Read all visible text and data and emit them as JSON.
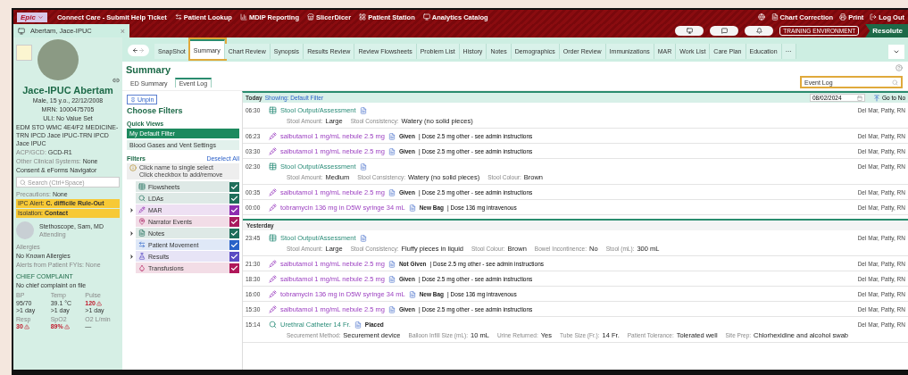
{
  "topbar": {
    "app_menu": "Epic",
    "links": [
      "Connect Care - Submit Help Ticket",
      "Patient Lookup",
      "MDIP Reporting",
      "SlicerDicer",
      "Patient Station",
      "Analytics Catalog"
    ],
    "actions": [
      "Chart Correction",
      "Print",
      "Log Out"
    ]
  },
  "patient_tab": {
    "name": "Abertam, Jace-IPUC",
    "close": "×"
  },
  "environment": {
    "badge": "TRAINING ENVIRONMENT",
    "status": "Resolute"
  },
  "sidebar": {
    "name": "Jace-IPUC Abertam",
    "demographics": [
      "Male, 15 y.o., 22/12/2008",
      "MRN: 1000475705",
      "ULI: No Value Set"
    ],
    "location": "EDM STO WMC 4E4/F2 MEDICINE-TRN IPCD Jace IPUC-TRN IPCD Jace IPUC",
    "info": [
      {
        "label": "ACP/GCD:",
        "value": "GCD-R1"
      },
      {
        "label": "Other Clinical Systems:",
        "value": "None"
      }
    ],
    "consent": "Consent & eForms Navigator",
    "search_placeholder": "Search (Ctrl+Space)",
    "precautions": {
      "label": "Precautions:",
      "value": "None"
    },
    "alerts": [
      {
        "label": "IPC Alert:",
        "value": "C. difficile Rule-Out"
      },
      {
        "label": "Isolation:",
        "value": "Contact"
      }
    ],
    "provider": {
      "name": "Stethoscope, Sam, MD",
      "role": "Attending"
    },
    "allergies": {
      "title": "Allergies",
      "value": "No Known Allergies",
      "fyi": "Alerts from Patient FYIs: None"
    },
    "chief_complaint": {
      "title": "CHIEF COMPLAINT",
      "value": "No chief complaint on file"
    },
    "vitals": [
      {
        "label": "BP",
        "value": "95/70",
        "time": ">1 day",
        "abnormal": false
      },
      {
        "label": "Temp",
        "value": "39.1 °C",
        "time": ">1 day",
        "abnormal": false
      },
      {
        "label": "Pulse",
        "value": "120",
        "time": ">1 day",
        "abnormal": true
      },
      {
        "label": "Resp",
        "value": "30",
        "abnormal": true
      },
      {
        "label": "SpO2",
        "value": "89%",
        "abnormal": true
      },
      {
        "label": "O2 L/min",
        "value": "—",
        "abnormal": false
      }
    ]
  },
  "tabs": [
    {
      "label": "SnapShot",
      "selected": false
    },
    {
      "label": "Summary",
      "selected": true
    },
    {
      "label": "Chart Review",
      "selected": false
    },
    {
      "label": "Synopsis",
      "selected": false
    },
    {
      "label": "Results Review",
      "selected": false
    },
    {
      "label": "Review Flowsheets",
      "selected": false
    },
    {
      "label": "Problem List",
      "selected": false
    },
    {
      "label": "History",
      "selected": false
    },
    {
      "label": "Notes",
      "selected": false
    },
    {
      "label": "Demographics",
      "selected": false
    },
    {
      "label": "Order Review",
      "selected": false
    },
    {
      "label": "Immunizations",
      "selected": false
    },
    {
      "label": "MAR",
      "selected": false
    },
    {
      "label": "Work List",
      "selected": false
    },
    {
      "label": "Care Plan",
      "selected": false
    },
    {
      "label": "Education",
      "selected": false
    },
    {
      "label": "···",
      "selected": false
    }
  ],
  "summary": {
    "title": "Summary",
    "subtabs": [
      {
        "label": "ED Summary",
        "selected": false
      },
      {
        "label": "Event Log",
        "selected": true
      }
    ],
    "search_value": "Event Log"
  },
  "filters": {
    "unpin": "Unpin",
    "title": "Choose Filters",
    "quick_views_title": "Quick Views",
    "quick_views": [
      {
        "label": "My Default Filter",
        "selected": true
      },
      {
        "label": "Blood Gases and Vent Settings",
        "selected": false
      }
    ],
    "filters_title": "Filters",
    "deselect_all": "Deselect All",
    "hint": [
      "Click name to single select",
      "Click checkbox to add/remove"
    ],
    "items": [
      {
        "label": "Flowsheets",
        "checked": true,
        "expandable": false,
        "color": "#1f6e5a"
      },
      {
        "label": "LDAs",
        "checked": true,
        "expandable": false,
        "color": "#1f6e5a"
      },
      {
        "label": "MAR",
        "checked": true,
        "expandable": true,
        "color": "#8e2cb0"
      },
      {
        "label": "Narrator Events",
        "checked": true,
        "expandable": false,
        "color": "#a8195e"
      },
      {
        "label": "Notes",
        "checked": true,
        "expandable": true,
        "color": "#1f6e5a"
      },
      {
        "label": "Patient Movement",
        "checked": true,
        "expandable": false,
        "color": "#2a62c8"
      },
      {
        "label": "Results",
        "checked": true,
        "expandable": true,
        "color": "#5b4cc4"
      },
      {
        "label": "Transfusions",
        "checked": true,
        "expandable": false,
        "color": "#b0185a"
      }
    ]
  },
  "event_log": {
    "showing": "Showing: Default Filter",
    "date": "08/02/2024",
    "go_to_now": "Go to No",
    "groups": [
      {
        "label": "Today",
        "events": [
          {
            "time": "06:30",
            "kind": "flowsheet",
            "title": "Stool Output/Assessment",
            "user": "Del Mar, Patty, RN",
            "fields": [
              {
                "label": "Stool Amount:",
                "value": "Large"
              },
              {
                "label": "Stool Consistency:",
                "value": "Watery (no solid pieces)"
              }
            ]
          },
          {
            "time": "06:23",
            "kind": "mar",
            "title": "salbutamol 1 mg/mL nebule 2.5 mg",
            "status": "Given",
            "detail": "| Dose 2.5 mg other - see admin instructions",
            "user": "Del Mar, Patty, RN"
          },
          {
            "time": "03:30",
            "kind": "mar",
            "title": "salbutamol 1 mg/mL nebule 2.5 mg",
            "status": "Given",
            "detail": "| Dose 2.5 mg other - see admin instructions",
            "user": "Del Mar, Patty, RN"
          },
          {
            "time": "02:30",
            "kind": "flowsheet",
            "title": "Stool Output/Assessment",
            "user": "Del Mar, Patty, RN",
            "fields": [
              {
                "label": "Stool Amount:",
                "value": "Medium"
              },
              {
                "label": "Stool Consistency:",
                "value": "Watery (no solid pieces)"
              },
              {
                "label": "Stool Colour:",
                "value": "Brown"
              }
            ]
          },
          {
            "time": "00:35",
            "kind": "mar",
            "title": "salbutamol 1 mg/mL nebule 2.5 mg",
            "status": "Given",
            "detail": "| Dose 2.5 mg other - see admin instructions",
            "user": "Del Mar, Patty, RN"
          },
          {
            "time": "00:00",
            "kind": "mar",
            "title": "tobramycin 136 mg in D5W syringe 34 mL",
            "status": "New Bag",
            "detail": "| Dose 136 mg intravenous",
            "user": "Del Mar, Patty, RN"
          }
        ]
      },
      {
        "label": "Yesterday",
        "events": [
          {
            "time": "23:45",
            "kind": "flowsheet",
            "title": "Stool Output/Assessment",
            "user": "Del Mar, Patty, RN",
            "fields": [
              {
                "label": "Stool Amount:",
                "value": "Large"
              },
              {
                "label": "Stool Consistency:",
                "value": "Fluffy pieces in liquid"
              },
              {
                "label": "Stool Colour:",
                "value": "Brown"
              },
              {
                "label": "Bowel Incontinence:",
                "value": "No"
              },
              {
                "label": "Stool (mL):",
                "value": "300 mL"
              }
            ]
          },
          {
            "time": "21:30",
            "kind": "mar",
            "title": "salbutamol 1 mg/mL nebule 2.5 mg",
            "status": "Not Given",
            "detail": "| Dose 2.5 mg other - see admin instructions",
            "user": "Del Mar, Patty, RN"
          },
          {
            "time": "18:30",
            "kind": "mar",
            "title": "salbutamol 1 mg/mL nebule 2.5 mg",
            "status": "Given",
            "detail": "| Dose 2.5 mg other - see admin instructions",
            "user": "Del Mar, Patty, RN"
          },
          {
            "time": "16:00",
            "kind": "mar",
            "title": "tobramycin 136 mg in D5W syringe 34 mL",
            "status": "New Bag",
            "detail": "| Dose 136 mg intravenous",
            "user": "Del Mar, Patty, RN"
          },
          {
            "time": "15:30",
            "kind": "mar",
            "title": "salbutamol 1 mg/mL nebule 2.5 mg",
            "status": "Given",
            "detail": "| Dose 2.5 mg other - see admin instructions",
            "user": "Del Mar, Patty, RN"
          },
          {
            "time": "15:14",
            "kind": "lda",
            "title": "Urethral Catheter 14 Fr.",
            "status": "Placed",
            "user": "Del Mar, Patty, RN",
            "fields": [
              {
                "label": "Securement Method:",
                "value": "Securement device"
              },
              {
                "label": "Balloon Infill Size (mL):",
                "value": "10 mL"
              },
              {
                "label": "Urine Returned:",
                "value": "Yes"
              },
              {
                "label": "Tube Size (Fr.):",
                "value": "14 Fr."
              },
              {
                "label": "Patient Tolerance:",
                "value": "Tolerated well"
              },
              {
                "label": "Site Prep:",
                "value": "Chlorhexidine and alcohol swab"
              }
            ]
          }
        ]
      }
    ]
  }
}
